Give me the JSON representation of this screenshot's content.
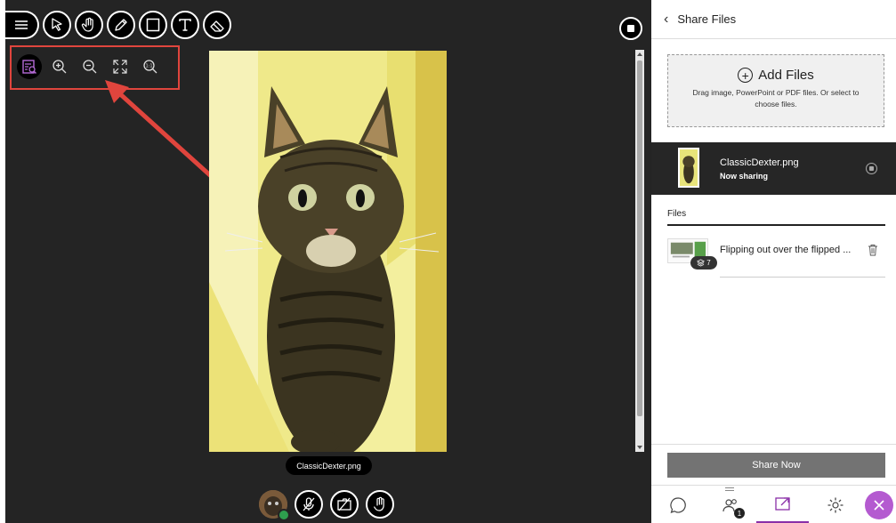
{
  "toolbar": {
    "menu_icon": "hamburger-menu-icon",
    "tools": [
      "select-pointer-icon",
      "pan-hand-icon",
      "pencil-icon",
      "rectangle-icon",
      "text-icon",
      "eraser-icon"
    ]
  },
  "zoom_controls": [
    "fit-page-icon",
    "zoom-in-icon",
    "zoom-out-icon",
    "fit-screen-icon",
    "actual-size-icon"
  ],
  "annotation": {
    "arrow_color": "#e0453d",
    "box_color": "#e0453d"
  },
  "stage": {
    "file_label": "ClassicDexter.png",
    "image_alt": "Cat peeking through stair railings"
  },
  "av_controls": [
    "avatar",
    "microphone-muted-icon",
    "camera-off-icon",
    "raise-hand-icon"
  ],
  "sidebar": {
    "header": {
      "back_icon": "chevron-left-icon",
      "title": "Share Files"
    },
    "dropzone": {
      "add_label": "Add Files",
      "hint": "Drag image, PowerPoint or PDF files. Or select to choose files."
    },
    "now_sharing": {
      "name": "ClassicDexter.png",
      "status": "Now sharing"
    },
    "files_heading": "Files",
    "files": [
      {
        "name": "Flipping out over the flipped ...",
        "count": "7"
      }
    ],
    "share_now_label": "Share Now",
    "nav": {
      "tabs": [
        "chat-icon",
        "participants-icon",
        "share-content-icon",
        "settings-icon"
      ],
      "participants_badge": "1",
      "active": "share-content-icon",
      "accent_color": "#8a2fa8"
    }
  }
}
